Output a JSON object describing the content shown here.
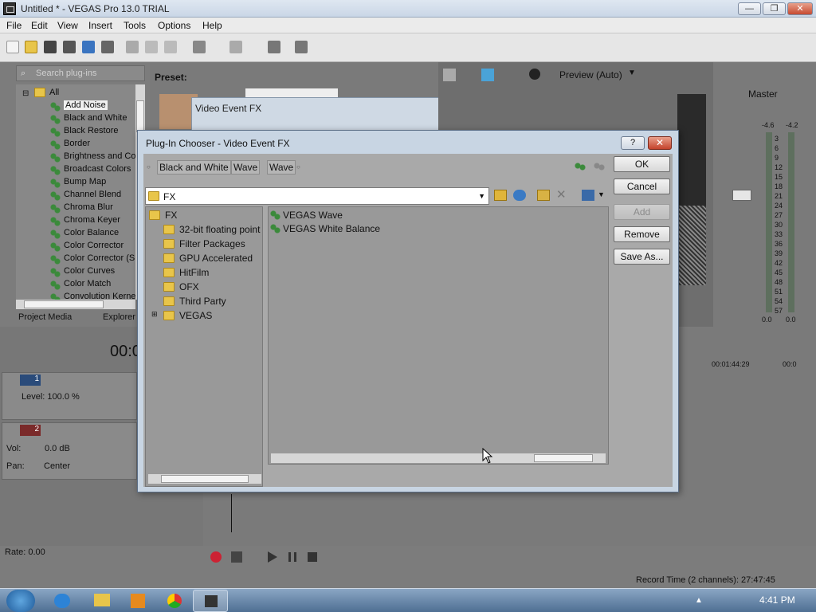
{
  "window": {
    "title": "Untitled * - VEGAS Pro 13.0 TRIAL"
  },
  "menu": [
    "File",
    "Edit",
    "View",
    "Insert",
    "Tools",
    "Options",
    "Help"
  ],
  "plugin_panel": {
    "search_placeholder": "Search plug-ins",
    "root": "All",
    "items": [
      "Add Noise",
      "Black and White",
      "Black Restore",
      "Border",
      "Brightness and Co",
      "Broadcast Colors",
      "Bump Map",
      "Channel Blend",
      "Chroma Blur",
      "Chroma Keyer",
      "Color Balance",
      "Color Corrector",
      "Color Corrector (S",
      "Color Curves",
      "Color Match",
      "Convolution Kerne"
    ],
    "tabs": [
      "Project Media",
      "Explorer"
    ]
  },
  "preset_label": "Preset:",
  "video_event_fx_title": "Video Event FX",
  "preview": {
    "mode": "Preview (Auto)"
  },
  "master": {
    "label": "Master",
    "left_top": "-4.6",
    "right_top": "-4.2",
    "scale": [
      "3",
      "6",
      "9",
      "12",
      "15",
      "18",
      "21",
      "24",
      "27",
      "30",
      "33",
      "36",
      "39",
      "42",
      "45",
      "48",
      "51",
      "54",
      "57"
    ],
    "left_bottom": "0.0",
    "right_bottom": "0.0"
  },
  "timeline": {
    "time": "00:0",
    "ruler_1": "00:01:44:29",
    "ruler_2": "00:0"
  },
  "tracks": [
    {
      "number": "1",
      "level_label": "Level: 100.0 %"
    },
    {
      "number": "2",
      "vol_label": "Vol:",
      "vol_value": "0.0 dB",
      "pan_label": "Pan:",
      "pan_value": "Center"
    }
  ],
  "rate": "Rate: 0.00",
  "status": {
    "record_time": "Record Time (2 channels): 27:47:45"
  },
  "taskbar": {
    "time": "4:41 PM"
  },
  "dialog": {
    "title": "Plug-In Chooser - Video Event FX",
    "help_label": "?",
    "close_label": "✕",
    "chain": [
      "Black and White",
      "Wave",
      "Wave"
    ],
    "path": "FX",
    "tree_root": "FX",
    "tree_items": [
      "32-bit floating point",
      "Filter Packages",
      "GPU Accelerated",
      "HitFilm",
      "OFX",
      "Third Party",
      "VEGAS"
    ],
    "files": [
      "VEGAS Wave",
      "VEGAS White Balance"
    ],
    "buttons": {
      "ok": "OK",
      "cancel": "Cancel",
      "add": "Add",
      "remove": "Remove",
      "save_as": "Save As..."
    }
  }
}
